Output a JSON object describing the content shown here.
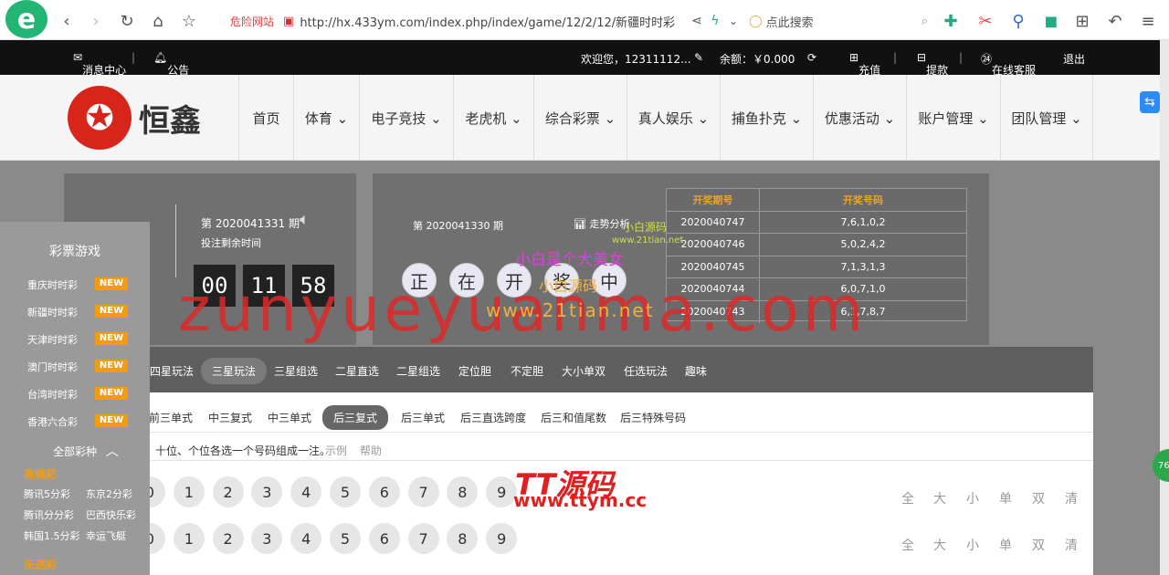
{
  "browser": {
    "danger_label": "危险网站",
    "url": "http://hx.433ym.com/index.php/index/game/12/2/12/新疆时时彩",
    "search_placeholder": "点此搜索"
  },
  "topbar": {
    "messages": "消息中心",
    "notice": "公告",
    "welcome": "欢迎您，12311112...",
    "balance": "余额：￥0.000",
    "recharge": "充值",
    "withdraw": "提款",
    "service": "在线客服",
    "logout": "退出"
  },
  "brand": {
    "name": "恒鑫"
  },
  "nav": [
    {
      "label": "首页"
    },
    {
      "label": "体育 ⌄"
    },
    {
      "label": "电子竞技 ⌄"
    },
    {
      "label": "老虎机 ⌄"
    },
    {
      "label": "综合彩票 ⌄"
    },
    {
      "label": "真人娱乐 ⌄"
    },
    {
      "label": "捕鱼扑克 ⌄"
    },
    {
      "label": "优惠活动 ⌄"
    },
    {
      "label": "账户管理 ⌄"
    },
    {
      "label": "团队管理 ⌄"
    }
  ],
  "current": {
    "period": "第 2020041331 期",
    "countdown_label": "投注剩余时间",
    "digits": [
      "00",
      "11",
      "58"
    ]
  },
  "last": {
    "period": "第 2020041330 期",
    "trend": "走势分析",
    "status_chars": [
      "正",
      "在",
      "开",
      "奖",
      "中"
    ]
  },
  "history": {
    "headers": [
      "开奖期号",
      "开奖号码"
    ],
    "rows": [
      [
        "2020040747",
        "7,6,1,0,2"
      ],
      [
        "2020040746",
        "5,0,2,4,2"
      ],
      [
        "2020040745",
        "7,1,3,1,3"
      ],
      [
        "2020040744",
        "6,0,7,1,0"
      ],
      [
        "2020040743",
        "6,1,7,8,7"
      ]
    ]
  },
  "play_tabs": [
    "四星玩法",
    "三星玩法",
    "三星组选",
    "二星直选",
    "二星组选",
    "定位胆",
    "不定胆",
    "大小单双",
    "任选玩法",
    "趣味"
  ],
  "sub_tabs": [
    "前三单式",
    "中三复式",
    "中三单式",
    "后三复式",
    "后三单式",
    "后三直选跨度",
    "后三和值尾数",
    "后三特殊号码"
  ],
  "hint": {
    "text": "十位、个位各选一个号码组成一注。",
    "example": "示例",
    "help": "帮助"
  },
  "numbers": [
    "0",
    "1",
    "2",
    "3",
    "4",
    "5",
    "6",
    "7",
    "8",
    "9"
  ],
  "actions": [
    "全",
    "大",
    "小",
    "单",
    "双",
    "清"
  ],
  "sidebar": {
    "title": "彩票游戏",
    "games": [
      "重庆时时彩",
      "新疆时时彩",
      "天津时时彩",
      "澳门时时彩",
      "台湾时时彩",
      "香港六合彩"
    ],
    "badge": "NEW",
    "all_label": "全部彩种",
    "high_freq": "高频彩",
    "hf_items": [
      "腾讯5分彩",
      "东京2分彩",
      "腾讯分分彩",
      "巴西快乐彩",
      "韩国1.5分彩",
      "幸运飞艇"
    ],
    "lotto": "乐透彩"
  },
  "watermarks": {
    "main": "zunyueyuanma.com",
    "ttym_title": "TT源码",
    "ttym_url": "www.ttym.cc",
    "xb1": "小白是个大美女",
    "xb2": "www.21tian.net",
    "xb3": "小白源码",
    "badge76": "76"
  }
}
